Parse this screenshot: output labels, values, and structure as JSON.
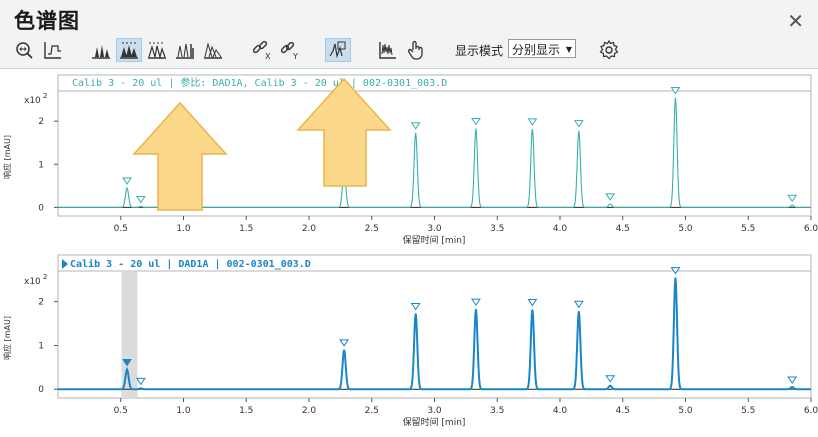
{
  "window": {
    "title": "色谱图",
    "close": "✕"
  },
  "toolbar": {
    "display_mode_label": "显示模式",
    "display_mode_value": "分别显示",
    "icons": [
      "zoom-fit-icon",
      "baseline-icon",
      "peaks-label-icon",
      "peaks-filled-icon",
      "peaks-outline-icon",
      "peaks-bars-icon",
      "peaks-stack-icon",
      "unlink-x-icon",
      "link-y-icon",
      "cursor-peak-icon",
      "spectrum-icon",
      "hand-pan-icon",
      "settings-gear-icon"
    ]
  },
  "charts": [
    {
      "header": "Calib 3 - 20 ul | 参比: DAD1A, Calib 3 - 20 ul | 002-0301_003.D",
      "y_exponent": "x10",
      "y_exponent_power": "2",
      "y_label": "响应 [mAU]",
      "x_label": "保留时间 [min]",
      "color": "#3aaeb0"
    },
    {
      "header": "Calib 3 - 20 ul | DAD1A | 002-0301_003.D",
      "y_exponent": "x10",
      "y_exponent_power": "2",
      "y_label": "响应 [mAU]",
      "x_label": "保留时间 [min]",
      "color": "#1a86c8",
      "highlight_time": 0.57
    }
  ],
  "axis": {
    "x_ticks": [
      "0.5",
      "1.0",
      "1.5",
      "2.0",
      "2.5",
      "3.0",
      "3.5",
      "4.0",
      "4.5",
      "5.0",
      "5.5",
      "6.0"
    ],
    "y_ticks": [
      "0",
      "1",
      "2"
    ]
  },
  "chart_data": {
    "type": "line",
    "x_range": [
      0.0,
      6.0
    ],
    "y_range": [
      -0.2,
      2.7
    ],
    "xlabel": "保留时间 [min]",
    "ylabel": "响应 [mAU]",
    "peaks": [
      {
        "t": 0.55,
        "h": 0.45
      },
      {
        "t": 0.66,
        "h": 0.02
      },
      {
        "t": 2.28,
        "h": 0.9
      },
      {
        "t": 2.85,
        "h": 1.73
      },
      {
        "t": 3.33,
        "h": 1.83
      },
      {
        "t": 3.78,
        "h": 1.82
      },
      {
        "t": 4.15,
        "h": 1.78
      },
      {
        "t": 4.4,
        "h": 0.08
      },
      {
        "t": 4.92,
        "h": 2.55
      },
      {
        "t": 5.85,
        "h": 0.05
      }
    ]
  }
}
